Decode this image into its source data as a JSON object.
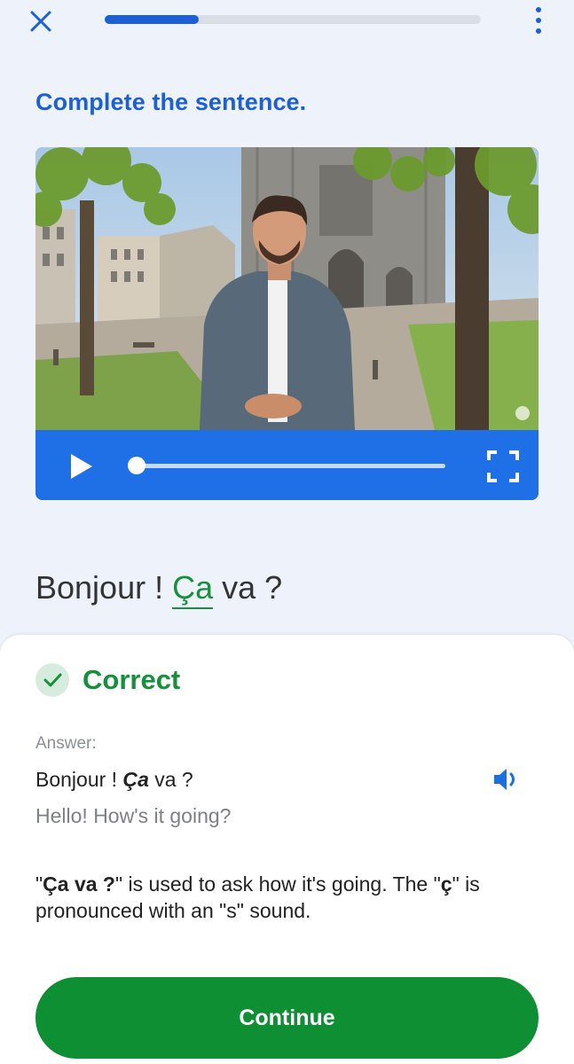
{
  "header": {
    "close_icon": "close-x-icon",
    "progress": 0.25,
    "more_icon": "more-vertical-icon",
    "accent_color": "#1c5fd6"
  },
  "exercise": {
    "instruction": "Complete the sentence.",
    "video": {
      "play_icon": "play-icon",
      "fullscreen_icon": "fullscreen-icon",
      "playback_position": 0.0
    },
    "sentence": {
      "before": "Bonjour ! ",
      "blank_answer": "Ça",
      "after": " va ?"
    }
  },
  "feedback": {
    "status_icon": "check-icon",
    "title": "Correct",
    "status_color": "#16903a",
    "answer_label": "Answer:",
    "answer": {
      "before": "Bonjour ! ",
      "highlight": "Ça",
      "after": " va ?"
    },
    "speaker_icon": "speaker-icon",
    "translation": "Hello! How's it going?",
    "explanation": {
      "part1": "\"",
      "bold1": "Ça va ?",
      "part2": "\" is used to ask how it's going. The \"",
      "bold2": "ç",
      "part3": "\" is pronounced with an \"s\" sound."
    },
    "continue_label": "Continue"
  }
}
